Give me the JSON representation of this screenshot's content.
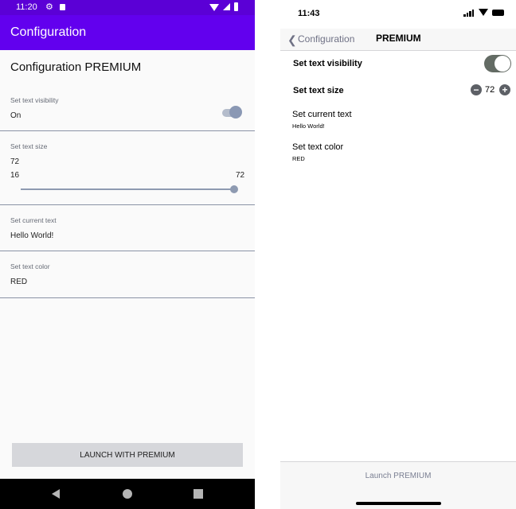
{
  "android": {
    "status": {
      "time": "11:20"
    },
    "appbar": {
      "title": "Configuration"
    },
    "heading": "Configuration PREMIUM",
    "visibility": {
      "label": "Set text visibility",
      "value": "On"
    },
    "size": {
      "label": "Set text size",
      "value": "72",
      "min": "16",
      "max": "72",
      "fraction": 1.0
    },
    "text": {
      "label": "Set current text",
      "value": "Hello World!"
    },
    "color": {
      "label": "Set text color",
      "value": "RED"
    },
    "launch_button": "LAUNCH WITH PREMIUM"
  },
  "ios": {
    "status": {
      "time": "11:43"
    },
    "nav": {
      "back_label": "Configuration",
      "title": "PREMIUM"
    },
    "visibility": {
      "label": "Set text visibility",
      "on": true
    },
    "size": {
      "label": "Set text size",
      "value": "72",
      "minus": "−",
      "plus": "+"
    },
    "text": {
      "title": "Set current text",
      "detail": "Hello World!"
    },
    "color": {
      "title": "Set text color",
      "detail": "RED"
    },
    "launch_button": "Launch PREMIUM"
  },
  "colors": {
    "android_primary": "#6200ee",
    "android_status": "#5b00d6",
    "ios_switch": "#636b64",
    "ios_tint": "#6f7185"
  }
}
